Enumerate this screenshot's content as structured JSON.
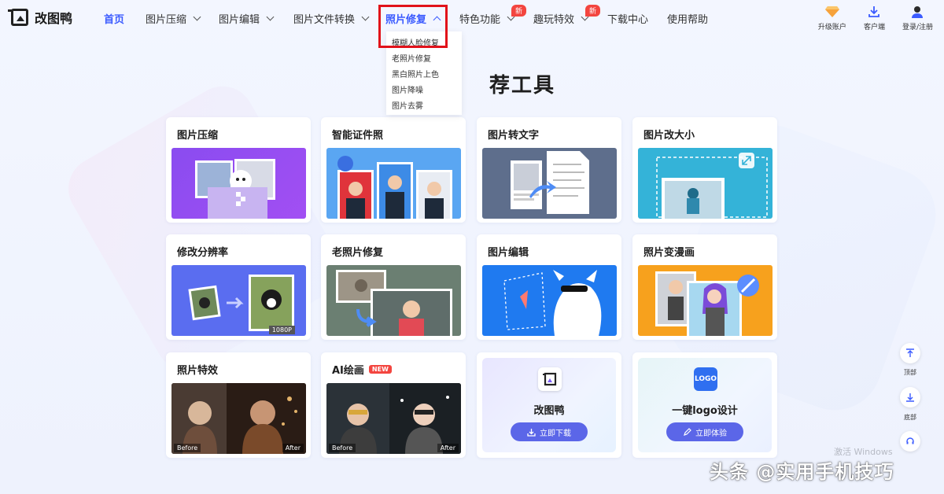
{
  "app": {
    "name": "改图鸭"
  },
  "nav": {
    "items": [
      {
        "label": "首页",
        "active": true
      },
      {
        "label": "图片压缩"
      },
      {
        "label": "图片编辑"
      },
      {
        "label": "图片文件转换"
      },
      {
        "label": "照片修复",
        "active": true
      },
      {
        "label": "特色功能",
        "badge": "新"
      },
      {
        "label": "趣玩特效",
        "badge": "新"
      },
      {
        "label": "下载中心"
      },
      {
        "label": "使用帮助"
      }
    ],
    "dropdown": [
      "模糊人脸修复",
      "老照片修复",
      "黑白照片上色",
      "图片降噪",
      "图片去雾"
    ]
  },
  "header_right": {
    "upgrade": "升级账户",
    "client": "客户端",
    "login": "登录/注册"
  },
  "page_title_visible": "荐工具",
  "cards": [
    {
      "title": "图片压缩"
    },
    {
      "title": "智能证件照"
    },
    {
      "title": "图片转文字"
    },
    {
      "title": "图片改大小"
    },
    {
      "title": "修改分辨率",
      "img_tag": "1080P"
    },
    {
      "title": "老照片修复"
    },
    {
      "title": "图片编辑"
    },
    {
      "title": "照片变漫画"
    },
    {
      "title": "照片特效",
      "before": "Before",
      "after": "After"
    },
    {
      "title": "AI绘画",
      "tag": "NEW",
      "before": "Before",
      "after": "After"
    }
  ],
  "promos": [
    {
      "name": "改图鸭",
      "button": "立即下载"
    },
    {
      "name": "一键logo设计",
      "button": "立即体验",
      "icon_text": "LOGO"
    }
  ],
  "side": {
    "top": "顶部",
    "bottom": "底部"
  },
  "activate_text": "激活 Windows",
  "watermark": "头条 @实用手机技巧",
  "colors": {
    "accent": "#3b5bff",
    "badge": "#f3453f",
    "highlight": "#e1121a",
    "button": "#5b66e8"
  }
}
